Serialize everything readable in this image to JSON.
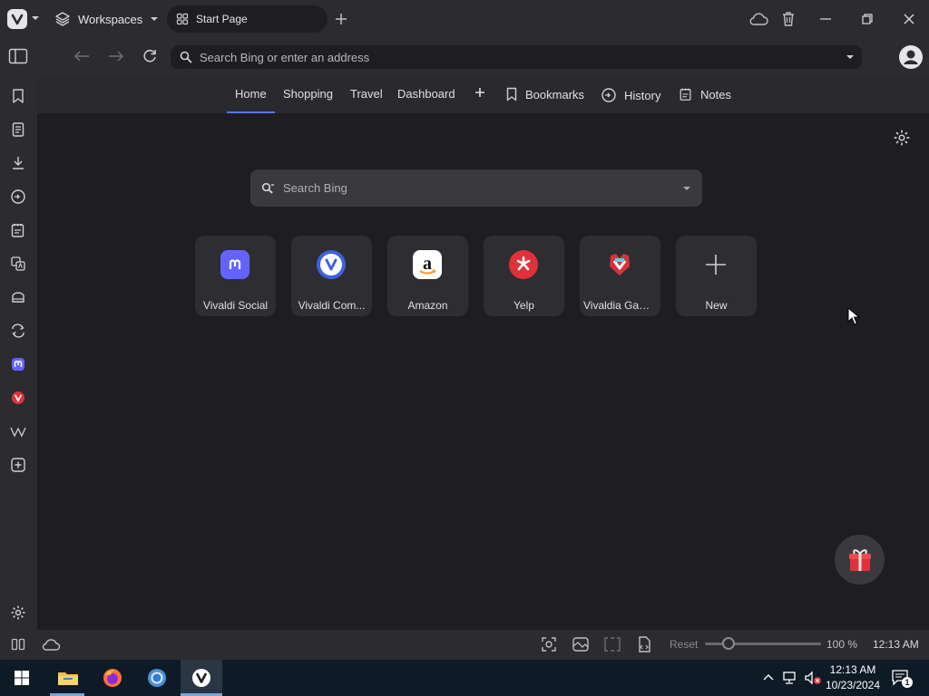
{
  "titlebar": {
    "workspaces_label": "Workspaces",
    "tab_title": "Start Page"
  },
  "addressbar": {
    "placeholder": "Search Bing or enter an address"
  },
  "startpage_nav": {
    "items": [
      "Home",
      "Shopping",
      "Travel",
      "Dashboard"
    ],
    "bookmarks_label": "Bookmarks",
    "history_label": "History",
    "notes_label": "Notes"
  },
  "search": {
    "placeholder": "Search Bing"
  },
  "speed_dials": [
    {
      "label": "Vivaldi Social",
      "icon": "mastodon-icon",
      "color": "#6364ff"
    },
    {
      "label": "Vivaldi Com...",
      "icon": "vivaldi-icon",
      "color": "#3c62e0"
    },
    {
      "label": "Amazon",
      "icon": "amazon-icon",
      "color": "#ffffff"
    },
    {
      "label": "Yelp",
      "icon": "yelp-icon",
      "color": "#e0303a"
    },
    {
      "label": "Vivaldia Gam...",
      "icon": "vivaldia-game-icon",
      "color": "#d9303a"
    },
    {
      "label": "New",
      "icon": "plus-icon",
      "color": "#cfcfd3"
    }
  ],
  "statusbar": {
    "reset_label": "Reset",
    "zoom_level": "100 %",
    "time": "12:13 AM"
  },
  "taskbar": {
    "time": "12:13 AM",
    "date": "10/23/2024",
    "notification_count": "1"
  },
  "colors": {
    "accent": "#5a75e6",
    "chrome_bg": "#2c2c30",
    "page_bg": "#1e1e22"
  }
}
